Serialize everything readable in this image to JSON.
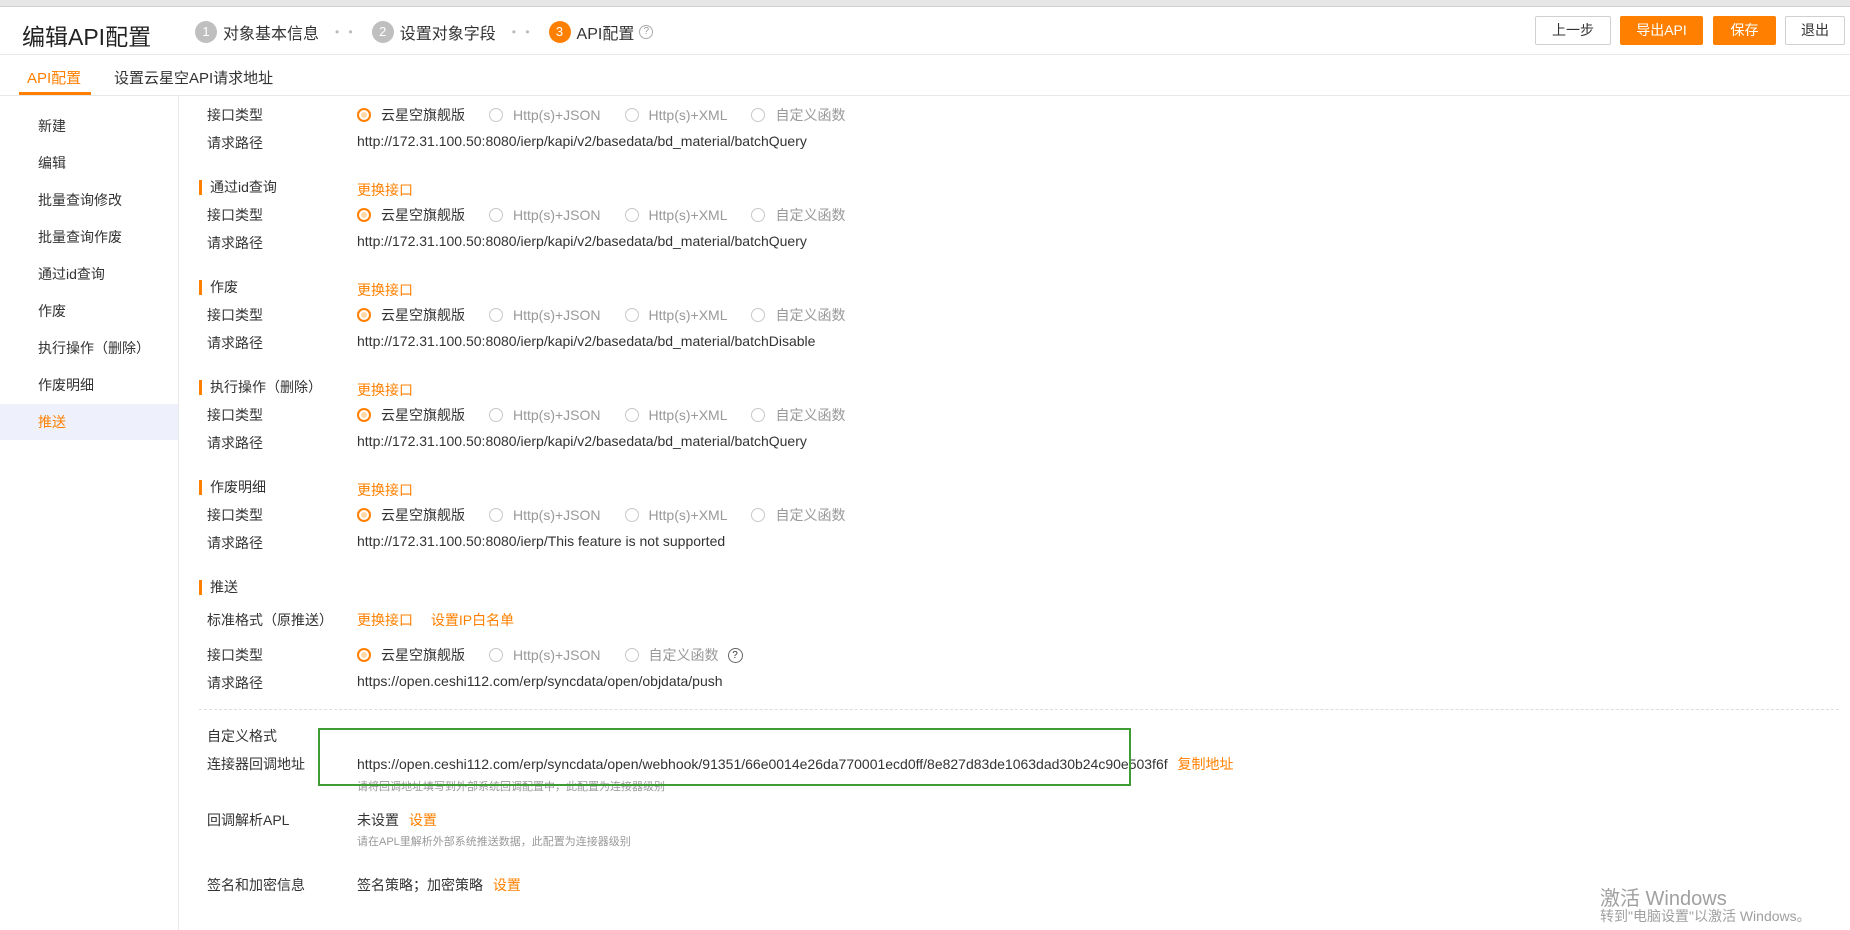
{
  "header": {
    "title": "编辑API配置",
    "steps": [
      {
        "num": "1",
        "label": "对象基本信息"
      },
      {
        "num": "2",
        "label": "设置对象字段"
      },
      {
        "num": "3",
        "label": "API配置"
      }
    ],
    "step_separator": "• •",
    "buttons": {
      "prev": "上一步",
      "export": "导出API",
      "save": "保存",
      "exit": "退出"
    }
  },
  "tabs": [
    {
      "label": "API配置",
      "active": true
    },
    {
      "label": "设置云星空API请求地址",
      "active": false
    }
  ],
  "sidebar": {
    "items": [
      "新建",
      "编辑",
      "批量查询修改",
      "批量查询作废",
      "通过id查询",
      "作废",
      "执行操作（删除）",
      "作废明细",
      "推送"
    ],
    "active_index": 8
  },
  "labels": {
    "interface_type": "接口类型",
    "request_path": "请求路径",
    "change_interface": "更换接口",
    "set_ip_whitelist": "设置IP白名单"
  },
  "radio_options": [
    "云星空旗舰版",
    "Http(s)+JSON",
    "Http(s)+XML",
    "自定义函数"
  ],
  "radio_options_push": [
    "云星空旗舰版",
    "Http(s)+JSON",
    "自定义函数"
  ],
  "sections": {
    "first": {
      "path": "http://172.31.100.50:8080/ierp/kapi/v2/basedata/bd_material/batchQuery"
    },
    "by_id": {
      "title": "通过id查询",
      "path": "http://172.31.100.50:8080/ierp/kapi/v2/basedata/bd_material/batchQuery"
    },
    "invalid": {
      "title": "作废",
      "path": "http://172.31.100.50:8080/ierp/kapi/v2/basedata/bd_material/batchDisable"
    },
    "delete": {
      "title": "执行操作（删除）",
      "path": "http://172.31.100.50:8080/ierp/kapi/v2/basedata/bd_material/batchQuery"
    },
    "invalid_detail": {
      "title": "作废明细",
      "path": "http://172.31.100.50:8080/ierp/This feature is not supported"
    },
    "push": {
      "title": "推送",
      "standard_format": "标准格式（原推送）",
      "path": "https://open.ceshi112.com/erp/syncdata/open/objdata/push"
    }
  },
  "custom": {
    "title": "自定义格式",
    "callback_label": "连接器回调地址",
    "callback_url": "https://open.ceshi112.com/erp/syncdata/open/webhook/91351/66e0014e26da770001ecd0ff/8e827d83de1063dad30b24c90e503f6f",
    "copy_link": "复制地址",
    "callback_hint": "请将回调地址填写到外部系统回调配置中，此配置为连接器级别",
    "apl_label": "回调解析APL",
    "apl_value": "未设置",
    "apl_set": "设置",
    "apl_hint": "请在APL里解析外部系统推送数据，此配置为连接器级别",
    "sign_label": "签名和加密信息",
    "sign_value": "签名策略；加密策略",
    "sign_set": "设置"
  },
  "watermark": {
    "line1": "激活 Windows",
    "line2": "转到\"电脑设置\"以激活 Windows。"
  },
  "colors": {
    "accent": "#ff8000",
    "highlight_box": "#3f9c35",
    "active_bg": "#eef1fb"
  }
}
